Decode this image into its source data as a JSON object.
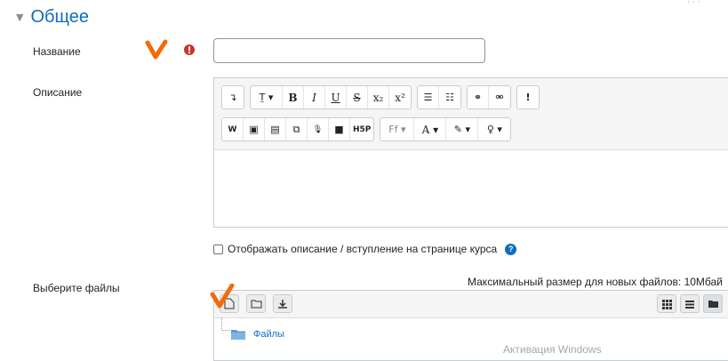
{
  "section": {
    "title": "Общее"
  },
  "name_field": {
    "label": "Название",
    "value": "",
    "required_icon": "exclamation-circle-icon"
  },
  "description": {
    "label": "Описание",
    "toolbar_row1": [
      {
        "name": "toggle-toolbar-icon",
        "text": "↴"
      },
      {
        "name": "text-style-dropdown",
        "text": "T̤ ▾"
      },
      {
        "name": "bold-button",
        "text": "B"
      },
      {
        "name": "italic-button",
        "text": "I"
      },
      {
        "name": "underline-button",
        "text": "U"
      },
      {
        "name": "strikethrough-button",
        "text": "S"
      },
      {
        "name": "subscript-button",
        "text": "x₂"
      },
      {
        "name": "superscript-button",
        "text": "x²"
      },
      {
        "name": "unordered-list-button",
        "text": "☰"
      },
      {
        "name": "ordered-list-button",
        "text": "☷"
      },
      {
        "name": "link-button",
        "text": "⚭"
      },
      {
        "name": "unlink-button",
        "text": "⚮"
      },
      {
        "name": "accessibility-button",
        "text": "!"
      }
    ],
    "toolbar_row2": [
      {
        "name": "word-paste-button",
        "text": "W"
      },
      {
        "name": "image-button",
        "text": "▣"
      },
      {
        "name": "media-button",
        "text": "▤"
      },
      {
        "name": "copy-button",
        "text": "⧉"
      },
      {
        "name": "record-audio-button",
        "text": "🎙"
      },
      {
        "name": "record-video-button",
        "text": "■"
      },
      {
        "name": "h5p-button",
        "text": "H5P"
      },
      {
        "name": "font-family-dropdown",
        "text": "Ff ▾"
      },
      {
        "name": "font-color-dropdown",
        "text": "A ▾"
      },
      {
        "name": "background-color-dropdown",
        "text": "✎ ▾"
      },
      {
        "name": "insert-dropdown",
        "text": "♀ ▾"
      }
    ]
  },
  "show_description": {
    "label": "Отображать описание / вступление на странице курса",
    "checked": false
  },
  "files": {
    "label": "Выберите файлы",
    "max_size": "Максимальный размер для новых файлов: 10Мбай",
    "folder_name": "Файлы"
  },
  "watermark": "Активация Windows",
  "accent_colors": {
    "link": "#0f6cbf",
    "annotation": "#f26b0a",
    "required": "#c0392b"
  }
}
